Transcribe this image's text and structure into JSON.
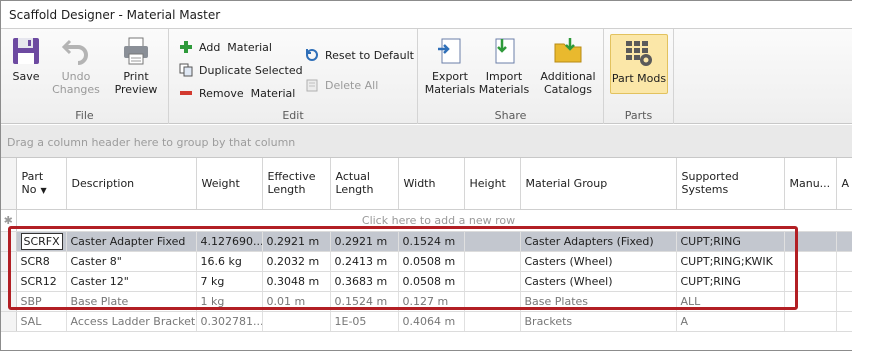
{
  "window": {
    "title": "Scaffold Designer - Material Master"
  },
  "ribbon": {
    "file": {
      "label": "File",
      "save": "Save",
      "undo": "Undo\nChanges",
      "print": "Print\nPreview"
    },
    "edit": {
      "label": "Edit",
      "add": "Add  Material",
      "duplicate": "Duplicate Selected",
      "remove": "Remove  Material",
      "reset": "Reset to Default",
      "delete_all": "Delete All"
    },
    "share": {
      "label": "Share",
      "export": "Export\nMaterials",
      "import": "Import\nMaterials",
      "catalogs": "Additional\nCatalogs"
    },
    "parts": {
      "label": "Parts",
      "part_mods": "Part Mods"
    }
  },
  "grid": {
    "group_hint": "Drag a column header here to group by that column",
    "new_row_hint": "Click here to add a new row",
    "columns": [
      "Part No",
      "Description",
      "Weight",
      "Effective Length",
      "Actual Length",
      "Width",
      "Height",
      "Material Group",
      "Supported Systems",
      "Manu...",
      "A"
    ],
    "rows": [
      {
        "part": "SCRFX",
        "desc": "Caster Adapter Fixed",
        "weight": "4.127690...",
        "eff": "0.2921 m",
        "act": "0.2921 m",
        "width": "0.1524 m",
        "height": "",
        "group": "Caster Adapters (Fixed)",
        "systems": "CUPT;RING",
        "manu": ""
      },
      {
        "part": "SCR8",
        "desc": "Caster 8\"",
        "weight": "16.6 kg",
        "eff": "0.2032 m",
        "act": "0.2413 m",
        "width": "0.0508 m",
        "height": "",
        "group": "Casters (Wheel)",
        "systems": "CUPT;RING;KWIK",
        "manu": ""
      },
      {
        "part": "SCR12",
        "desc": "Caster 12\"",
        "weight": "7 kg",
        "eff": "0.3048 m",
        "act": "0.3683 m",
        "width": "0.0508 m",
        "height": "",
        "group": "Casters (Wheel)",
        "systems": "CUPT;RING",
        "manu": ""
      },
      {
        "part": "SBP",
        "desc": "Base Plate",
        "weight": "1 kg",
        "eff": "0.01 m",
        "act": "0.1524 m",
        "width": "0.127 m",
        "height": "",
        "group": "Base Plates",
        "systems": "ALL",
        "manu": ""
      },
      {
        "part": "SAL",
        "desc": "Access Ladder Bracket",
        "weight": "0.302781...",
        "eff": "",
        "act": "1E-05",
        "width": "0.4064 m",
        "height": "",
        "group": "Brackets",
        "systems": "A",
        "manu": ""
      }
    ]
  },
  "colors": {
    "highlight": "#b21f24",
    "selected_row": "#c3c7cf",
    "active_button": "#fbe7a8"
  }
}
